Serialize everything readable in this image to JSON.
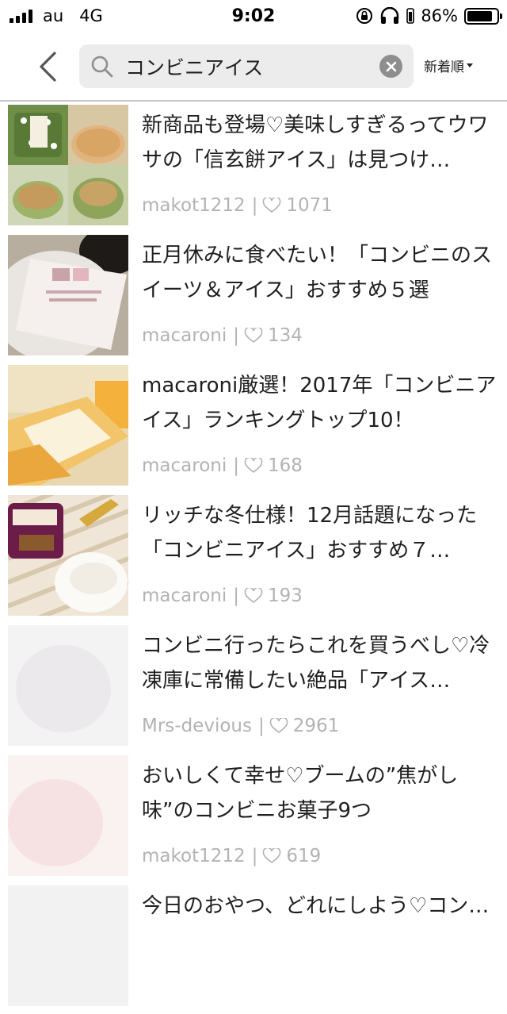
{
  "status_bar": {
    "carrier": "au",
    "network": "4G",
    "time": "9:02",
    "battery_percent": "86%",
    "battery_level": 0.86
  },
  "search": {
    "query": "コンビニアイス",
    "sort_label": "新着順"
  },
  "articles": [
    {
      "title": "新商品も登場♡美味しすぎるってウワサの「信玄餅アイス」は見つけ…",
      "author": "makot1212",
      "likes": "1071"
    },
    {
      "title": "正月休みに食べたい！「コンビニのスイーツ＆アイス」おすすめ５選",
      "author": "macaroni",
      "likes": "134"
    },
    {
      "title": "macaroni厳選！2017年「コンビニアイス」ランキングトップ10！",
      "author": "macaroni",
      "likes": "168"
    },
    {
      "title": "リッチな冬仕様！12月話題になった「コンビニアイス」おすすめ７…",
      "author": "macaroni",
      "likes": "193"
    },
    {
      "title": "コンビニ行ったらこれを買うべし♡冷凍庫に常備したい絶品「アイス…",
      "author": "Mrs-devious",
      "likes": "2961"
    },
    {
      "title": "おいしくて幸せ♡ブームの”焦がし味”のコンビニお菓子9つ",
      "author": "makot1212",
      "likes": "619"
    },
    {
      "title": "今日のおやつ、どれにしよう♡コン…",
      "author": "",
      "likes": ""
    }
  ],
  "colors": {
    "meta_text": "#b3b3b3",
    "search_bg": "#ececec",
    "divider": "#c8c8c8"
  }
}
